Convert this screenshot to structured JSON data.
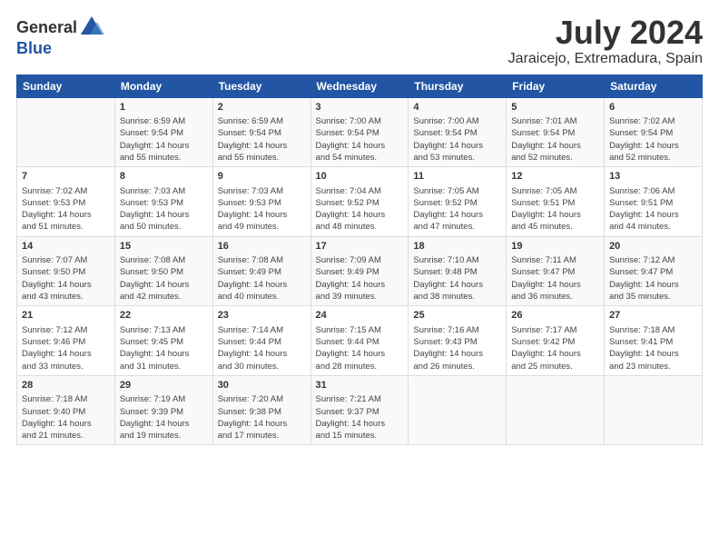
{
  "header": {
    "logo_general": "General",
    "logo_blue": "Blue",
    "month_title": "July 2024",
    "location": "Jaraicejo, Extremadura, Spain"
  },
  "weekdays": [
    "Sunday",
    "Monday",
    "Tuesday",
    "Wednesday",
    "Thursday",
    "Friday",
    "Saturday"
  ],
  "weeks": [
    [
      {
        "day": "",
        "info": ""
      },
      {
        "day": "1",
        "info": "Sunrise: 6:59 AM\nSunset: 9:54 PM\nDaylight: 14 hours\nand 55 minutes."
      },
      {
        "day": "2",
        "info": "Sunrise: 6:59 AM\nSunset: 9:54 PM\nDaylight: 14 hours\nand 55 minutes."
      },
      {
        "day": "3",
        "info": "Sunrise: 7:00 AM\nSunset: 9:54 PM\nDaylight: 14 hours\nand 54 minutes."
      },
      {
        "day": "4",
        "info": "Sunrise: 7:00 AM\nSunset: 9:54 PM\nDaylight: 14 hours\nand 53 minutes."
      },
      {
        "day": "5",
        "info": "Sunrise: 7:01 AM\nSunset: 9:54 PM\nDaylight: 14 hours\nand 52 minutes."
      },
      {
        "day": "6",
        "info": "Sunrise: 7:02 AM\nSunset: 9:54 PM\nDaylight: 14 hours\nand 52 minutes."
      }
    ],
    [
      {
        "day": "7",
        "info": "Sunrise: 7:02 AM\nSunset: 9:53 PM\nDaylight: 14 hours\nand 51 minutes."
      },
      {
        "day": "8",
        "info": "Sunrise: 7:03 AM\nSunset: 9:53 PM\nDaylight: 14 hours\nand 50 minutes."
      },
      {
        "day": "9",
        "info": "Sunrise: 7:03 AM\nSunset: 9:53 PM\nDaylight: 14 hours\nand 49 minutes."
      },
      {
        "day": "10",
        "info": "Sunrise: 7:04 AM\nSunset: 9:52 PM\nDaylight: 14 hours\nand 48 minutes."
      },
      {
        "day": "11",
        "info": "Sunrise: 7:05 AM\nSunset: 9:52 PM\nDaylight: 14 hours\nand 47 minutes."
      },
      {
        "day": "12",
        "info": "Sunrise: 7:05 AM\nSunset: 9:51 PM\nDaylight: 14 hours\nand 45 minutes."
      },
      {
        "day": "13",
        "info": "Sunrise: 7:06 AM\nSunset: 9:51 PM\nDaylight: 14 hours\nand 44 minutes."
      }
    ],
    [
      {
        "day": "14",
        "info": "Sunrise: 7:07 AM\nSunset: 9:50 PM\nDaylight: 14 hours\nand 43 minutes."
      },
      {
        "day": "15",
        "info": "Sunrise: 7:08 AM\nSunset: 9:50 PM\nDaylight: 14 hours\nand 42 minutes."
      },
      {
        "day": "16",
        "info": "Sunrise: 7:08 AM\nSunset: 9:49 PM\nDaylight: 14 hours\nand 40 minutes."
      },
      {
        "day": "17",
        "info": "Sunrise: 7:09 AM\nSunset: 9:49 PM\nDaylight: 14 hours\nand 39 minutes."
      },
      {
        "day": "18",
        "info": "Sunrise: 7:10 AM\nSunset: 9:48 PM\nDaylight: 14 hours\nand 38 minutes."
      },
      {
        "day": "19",
        "info": "Sunrise: 7:11 AM\nSunset: 9:47 PM\nDaylight: 14 hours\nand 36 minutes."
      },
      {
        "day": "20",
        "info": "Sunrise: 7:12 AM\nSunset: 9:47 PM\nDaylight: 14 hours\nand 35 minutes."
      }
    ],
    [
      {
        "day": "21",
        "info": "Sunrise: 7:12 AM\nSunset: 9:46 PM\nDaylight: 14 hours\nand 33 minutes."
      },
      {
        "day": "22",
        "info": "Sunrise: 7:13 AM\nSunset: 9:45 PM\nDaylight: 14 hours\nand 31 minutes."
      },
      {
        "day": "23",
        "info": "Sunrise: 7:14 AM\nSunset: 9:44 PM\nDaylight: 14 hours\nand 30 minutes."
      },
      {
        "day": "24",
        "info": "Sunrise: 7:15 AM\nSunset: 9:44 PM\nDaylight: 14 hours\nand 28 minutes."
      },
      {
        "day": "25",
        "info": "Sunrise: 7:16 AM\nSunset: 9:43 PM\nDaylight: 14 hours\nand 26 minutes."
      },
      {
        "day": "26",
        "info": "Sunrise: 7:17 AM\nSunset: 9:42 PM\nDaylight: 14 hours\nand 25 minutes."
      },
      {
        "day": "27",
        "info": "Sunrise: 7:18 AM\nSunset: 9:41 PM\nDaylight: 14 hours\nand 23 minutes."
      }
    ],
    [
      {
        "day": "28",
        "info": "Sunrise: 7:18 AM\nSunset: 9:40 PM\nDaylight: 14 hours\nand 21 minutes."
      },
      {
        "day": "29",
        "info": "Sunrise: 7:19 AM\nSunset: 9:39 PM\nDaylight: 14 hours\nand 19 minutes."
      },
      {
        "day": "30",
        "info": "Sunrise: 7:20 AM\nSunset: 9:38 PM\nDaylight: 14 hours\nand 17 minutes."
      },
      {
        "day": "31",
        "info": "Sunrise: 7:21 AM\nSunset: 9:37 PM\nDaylight: 14 hours\nand 15 minutes."
      },
      {
        "day": "",
        "info": ""
      },
      {
        "day": "",
        "info": ""
      },
      {
        "day": "",
        "info": ""
      }
    ]
  ]
}
